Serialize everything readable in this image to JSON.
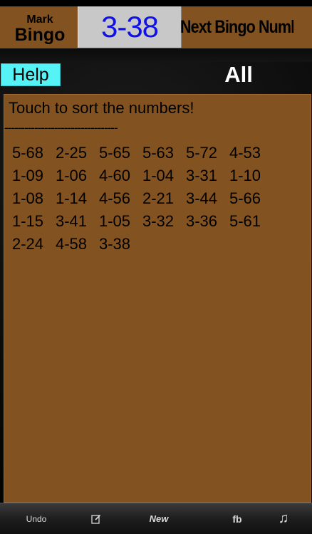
{
  "header": {
    "brand_line1": "Mark",
    "brand_line2": "Bingo",
    "current_number": "3-38",
    "next_label": "Next Bingo Number"
  },
  "controls": {
    "help_label": "Help",
    "filter_label": "All"
  },
  "panel": {
    "instruction": "Touch to sort the numbers!",
    "divider": "----------------------------------",
    "called_numbers": [
      "5-68",
      "2-25",
      "5-65",
      "5-63",
      "5-72",
      "4-53",
      "1-09",
      "1-06",
      "4-60",
      "1-04",
      "3-31",
      "1-10",
      "1-08",
      "1-14",
      "4-56",
      "2-21",
      "3-44",
      "5-66",
      "1-15",
      "3-41",
      "1-05",
      "3-32",
      "3-36",
      "5-61",
      "2-24",
      "4-58",
      "3-38"
    ]
  },
  "toolbar": {
    "undo_label": "Undo",
    "edit_icon": "edit-icon",
    "new_label": "New",
    "fb_label": "fb",
    "music_icon": "music-note-icon",
    "music_glyph": "♫"
  },
  "colors": {
    "panel_brown": "#835221",
    "help_cyan": "#55f3f5",
    "current_number_blue": "#1010e8",
    "current_box_gray": "#c8c8c8"
  }
}
